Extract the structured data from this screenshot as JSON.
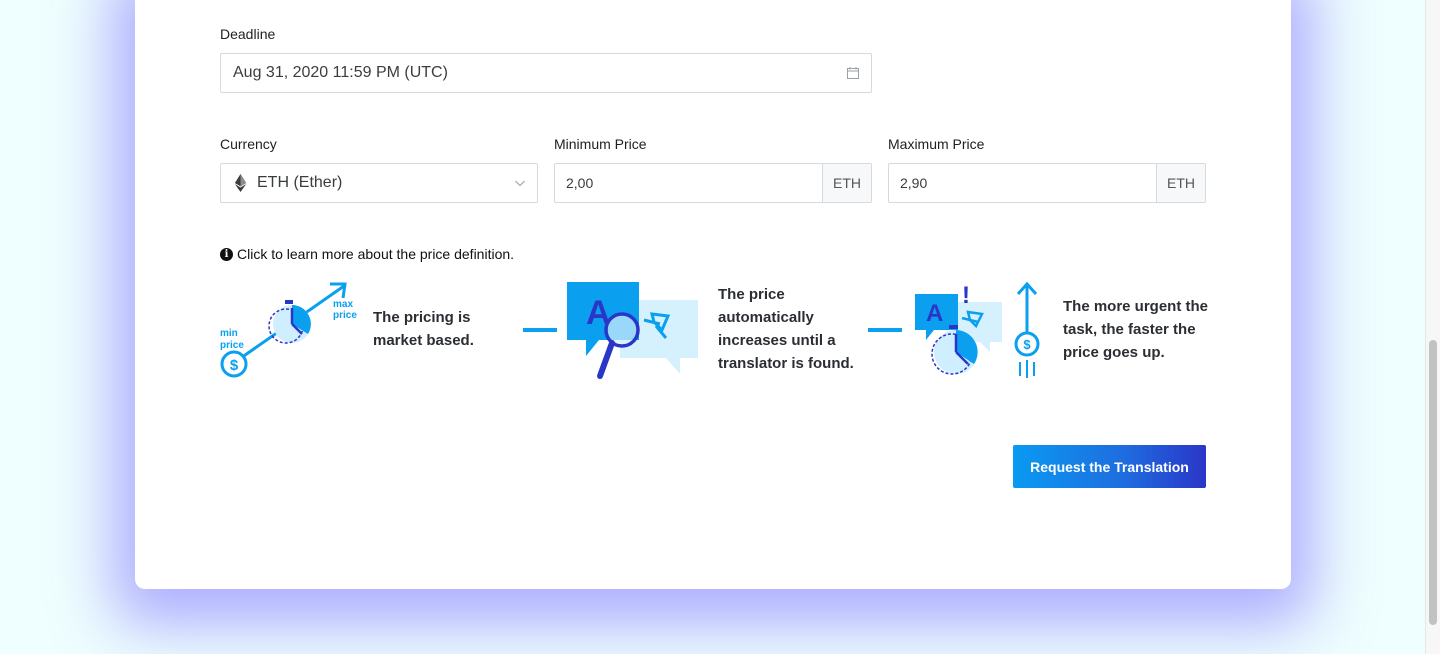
{
  "deadline": {
    "label": "Deadline",
    "value": "Aug 31, 2020 11:59 PM (UTC)",
    "icon": "calendar-icon"
  },
  "currency": {
    "label": "Currency",
    "value": "ETH (Ether)",
    "icon": "ethereum-icon"
  },
  "min_price": {
    "label": "Minimum Price",
    "value": "2,00",
    "unit": "ETH"
  },
  "max_price": {
    "label": "Maximum Price",
    "value": "2,90",
    "unit": "ETH"
  },
  "info": {
    "text": "Click to learn more about the price definition.",
    "icon": "info-icon"
  },
  "steps": [
    {
      "text": "The pricing is market based.",
      "illustration": {
        "min_label_1": "min",
        "min_label_2": "price",
        "max_label_1": "max",
        "max_label_2": "price",
        "currency_symbol": "$"
      }
    },
    {
      "text": "The price automatically increases until a translator is found.",
      "illustration": {
        "glyph": "A"
      }
    },
    {
      "text": "The more urgent the task, the faster the price goes up.",
      "illustration": {
        "glyph": "A",
        "alert": "!",
        "currency_symbol": "$"
      }
    }
  ],
  "cta": {
    "label": "Request the Translation"
  },
  "colors": {
    "accent": "#0b9ff0",
    "accent_dark": "#2a36c8",
    "card_shadow": "#786eff"
  }
}
